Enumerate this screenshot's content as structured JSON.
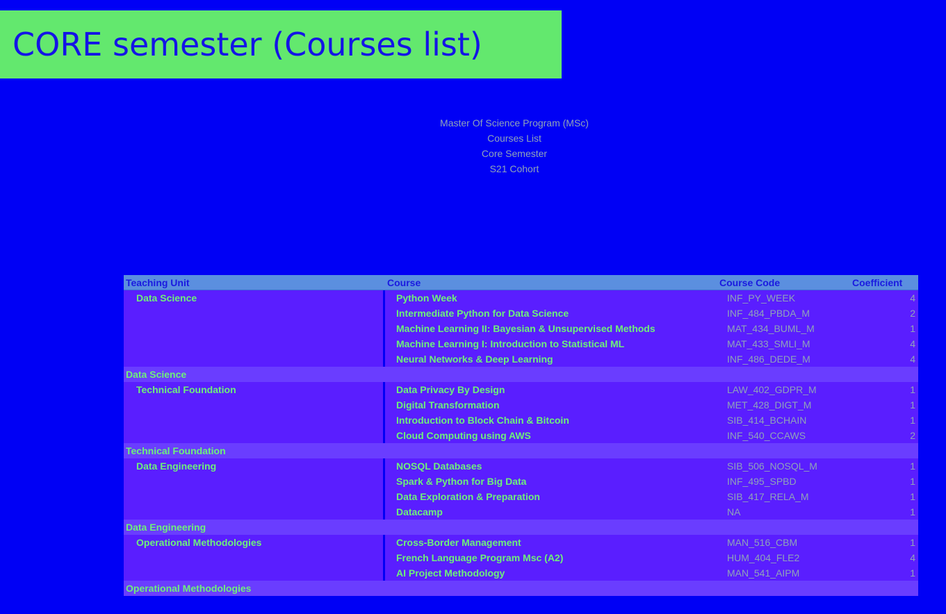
{
  "title": "CORE semester (Courses list)",
  "header_lines": [
    "Master Of Science Program (MSc)",
    "Courses List",
    "Core Semester",
    "S21 Cohort"
  ],
  "table": {
    "columns": [
      "Teaching Unit",
      "Course",
      "Course Code",
      "Coefficient"
    ],
    "groups": [
      {
        "unit": "Data Science",
        "rows": [
          {
            "course": "Python Week",
            "code": "INF_PY_WEEK",
            "coef": "4"
          },
          {
            "course": "Intermediate Python for Data Science",
            "code": "INF_484_PBDA_M",
            "coef": "2"
          },
          {
            "course": "Machine Learning II: Bayesian & Unsupervised Methods",
            "code": "MAT_434_BUML_M",
            "coef": "1"
          },
          {
            "course": "Machine Learning I: Introduction to Statistical ML",
            "code": "MAT_433_SMLI_M",
            "coef": "4"
          },
          {
            "course": "Neural Networks & Deep Learning",
            "code": "INF_486_DEDE_M",
            "coef": "4"
          }
        ],
        "total_label": "Data Science"
      },
      {
        "unit": "Technical Foundation",
        "rows": [
          {
            "course": "Data Privacy By Design",
            "code": "LAW_402_GDPR_M",
            "coef": "1"
          },
          {
            "course": "Digital Transformation",
            "code": "MET_428_DIGT_M",
            "coef": "1"
          },
          {
            "course": "Introduction to Block Chain & Bitcoin",
            "code": "SIB_414_BCHAIN",
            "coef": "1"
          },
          {
            "course": "Cloud Computing using AWS",
            "code": "INF_540_CCAWS",
            "coef": "2"
          }
        ],
        "total_label": "Technical Foundation"
      },
      {
        "unit": "Data Engineering",
        "rows": [
          {
            "course": "NOSQL Databases",
            "code": "SIB_506_NOSQL_M",
            "coef": "1"
          },
          {
            "course": "Spark & Python for Big Data",
            "code": "INF_495_SPBD",
            "coef": "1"
          },
          {
            "course": "Data Exploration & Preparation",
            "code": "SIB_417_RELA_M",
            "coef": "1"
          },
          {
            "course": "Datacamp",
            "code": "NA",
            "coef": "1"
          }
        ],
        "total_label": "Data Engineering"
      },
      {
        "unit": "Operational Methodologies",
        "rows": [
          {
            "course": "Cross-Border Management",
            "code": "MAN_516_CBM",
            "coef": "1"
          },
          {
            "course": "French Language Program Msc (A2)",
            "code": "HUM_404_FLE2",
            "coef": "4"
          },
          {
            "course": "AI Project Methodology",
            "code": "MAN_541_AIPM",
            "coef": "1"
          }
        ],
        "total_label": "Operational Methodologies"
      }
    ]
  },
  "colors": {
    "background": "#0000f5",
    "banner": "#63e86e",
    "header_row": "#5b8fdf",
    "data_row": "#5a1eff",
    "total_row": "#6a3dff",
    "text_green": "#6ef07a"
  }
}
